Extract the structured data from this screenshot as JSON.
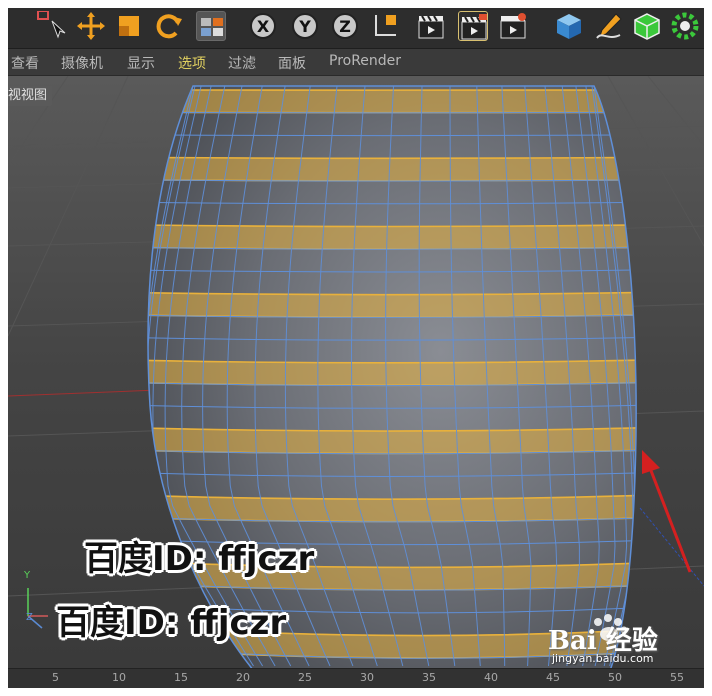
{
  "toolbar": {
    "buttons": [
      {
        "name": "select-tool-button",
        "icon": "select-arrow-icon"
      },
      {
        "name": "move-tool-button",
        "icon": "move-cross-icon"
      },
      {
        "name": "scale-tool-button",
        "icon": "scale-box-icon"
      },
      {
        "name": "rotate-tool-button",
        "icon": "rotate-icon"
      },
      {
        "name": "recent-tools-button",
        "icon": "recent-tools-icon"
      },
      {
        "name": "x-axis-lock-button",
        "icon": "x-axis-icon",
        "label": "X"
      },
      {
        "name": "y-axis-lock-button",
        "icon": "y-axis-icon",
        "label": "Y"
      },
      {
        "name": "z-axis-lock-button",
        "icon": "z-axis-icon",
        "label": "Z"
      },
      {
        "name": "coordinate-system-button",
        "icon": "coordinate-system-icon"
      },
      {
        "name": "render-view-button",
        "icon": "clapper-icon"
      },
      {
        "name": "render-picture-viewer-button",
        "icon": "clapper-icon"
      },
      {
        "name": "edit-render-settings-button",
        "icon": "clapper-gear-icon"
      },
      {
        "name": "cube-object-button",
        "icon": "cube-icon"
      },
      {
        "name": "pen-spline-button",
        "icon": "pen-icon"
      },
      {
        "name": "subdivision-button",
        "icon": "subdivision-icon"
      },
      {
        "name": "array-button",
        "icon": "array-gear-icon"
      }
    ]
  },
  "menubar": {
    "items": [
      {
        "label": "查看",
        "active": false
      },
      {
        "label": "摄像机",
        "active": false
      },
      {
        "label": "显示",
        "active": false
      },
      {
        "label": "选项",
        "active": true
      },
      {
        "label": "过滤",
        "active": false
      },
      {
        "label": "面板",
        "active": false
      },
      {
        "label": "ProRender",
        "active": false
      }
    ]
  },
  "viewport": {
    "label": "视视图",
    "axes": {
      "y": "Y",
      "z": "Z"
    }
  },
  "watermark": {
    "line1": "百度ID: ffjczr",
    "line2": "百度ID: ffjczr",
    "logo_text": "Bai 经验",
    "logo_url": "jingyan.baidu.com"
  },
  "ruler": {
    "ticks": [
      "5",
      "10",
      "15",
      "20",
      "25",
      "30",
      "35",
      "40",
      "45",
      "50",
      "55"
    ]
  },
  "colors": {
    "selected_poly": "#e8b13c",
    "wire": "#5f8fd8",
    "menu_active": "#e0d060",
    "arrow": "#d42020"
  }
}
